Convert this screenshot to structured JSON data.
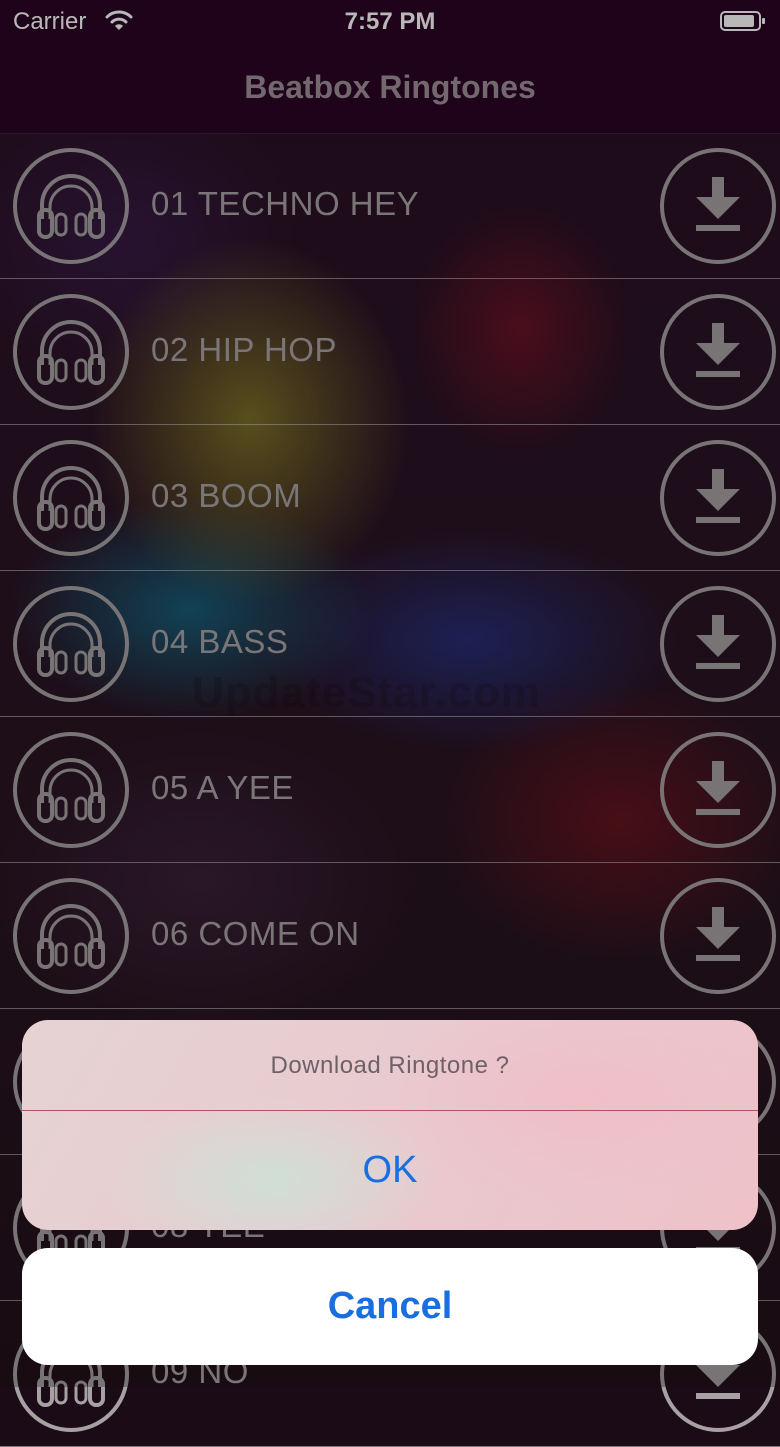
{
  "status_bar": {
    "carrier": "Carrier",
    "time": "7:57 PM"
  },
  "nav": {
    "title": "Beatbox Ringtones"
  },
  "ringtones": [
    {
      "label": "01 TECHNO HEY"
    },
    {
      "label": "02 HIP HOP"
    },
    {
      "label": "03 BOOM"
    },
    {
      "label": "04 BASS"
    },
    {
      "label": "05 A YEE"
    },
    {
      "label": "06 COME ON"
    },
    {
      "label": ""
    },
    {
      "label": "08 YEE"
    },
    {
      "label": "09 NO"
    }
  ],
  "watermark": "UpdateStar.com",
  "action_sheet": {
    "title": "Download Ringtone ?",
    "ok_label": "OK",
    "cancel_label": "Cancel"
  },
  "icons": {
    "row_leading": "headphones-icon",
    "row_trailing": "download-icon",
    "status": [
      "wifi-icon",
      "battery-icon"
    ]
  },
  "colors": {
    "bar_background": "#2a0524",
    "row_text": "#a9a3a6",
    "action_blue": "#1a6fe0"
  }
}
